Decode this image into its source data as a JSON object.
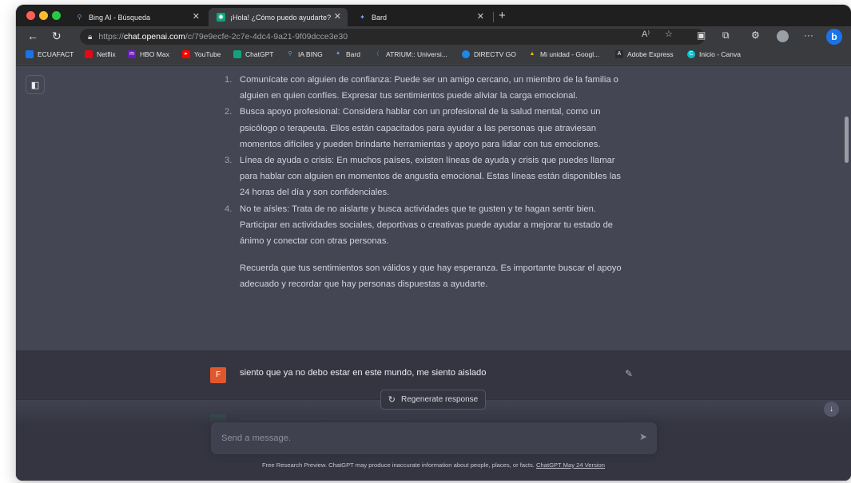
{
  "browser": {
    "tabs": [
      {
        "title": "Bing AI - Búsqueda",
        "icon": "search-icon",
        "active": false
      },
      {
        "title": "¡Hola! ¿Cómo puedo ayudarte?",
        "icon": "chatgpt-icon",
        "active": true
      },
      {
        "title": "Bard",
        "icon": "bard-sparkle-icon",
        "active": false
      }
    ],
    "url": {
      "prefix": "https://",
      "host": "chat.openai.com",
      "path": "/c/79e9ecfe-2c7e-4dc4-9a21-9f09dcce3e30"
    },
    "bookmarks": [
      {
        "label": "ECUAFACT",
        "color": "#1a73e8"
      },
      {
        "label": "Netflix",
        "color": "#e50914"
      },
      {
        "label": "HBO Max",
        "color": "#6a1bbf"
      },
      {
        "label": "YouTube",
        "color": "#ff0000"
      },
      {
        "label": "ChatGPT",
        "color": "#10a37f"
      },
      {
        "label": "IA BING",
        "color": "#1a73e8"
      },
      {
        "label": "Bard",
        "color": "#4b8bf5"
      },
      {
        "label": "ATRIUM:: Universi...",
        "color": "#1e90ff"
      },
      {
        "label": "DIRECTV GO",
        "color": "#1e88e5"
      },
      {
        "label": "Mi unidad - Googl...",
        "color": "#fbbc04"
      },
      {
        "label": "Adobe Express",
        "color": "#2b2b2b"
      },
      {
        "label": "Inicio - Canva",
        "color": "#00c4cc"
      }
    ]
  },
  "chat": {
    "assistant_list": [
      {
        "num": "1.",
        "text": "Comunícate con alguien de confianza: Puede ser un amigo cercano, un miembro de la familia o alguien en quien confíes. Expresar tus sentimientos puede aliviar la carga emocional."
      },
      {
        "num": "2.",
        "text": "Busca apoyo profesional: Considera hablar con un profesional de la salud mental, como un psicólogo o terapeuta. Ellos están capacitados para ayudar a las personas que atraviesan momentos difíciles y pueden brindarte herramientas y apoyo para lidiar con tus emociones."
      },
      {
        "num": "3.",
        "text": "Línea de ayuda o crisis: En muchos países, existen líneas de ayuda y crisis que puedes llamar para hablar con alguien en momentos de angustia emocional. Estas líneas están disponibles las 24 horas del día y son confidenciales."
      },
      {
        "num": "4.",
        "text": "No te aísles: Trata de no aislarte y busca actividades que te gusten y te hagan sentir bien. Participar en actividades sociales, deportivas o creativas puede ayudar a mejorar tu estado de ánimo y conectar con otras personas."
      }
    ],
    "assistant_closing": "Recuerda que tus sentimientos son válidos y que hay esperanza. Es importante buscar el apoyo adecuado y recordar que hay personas dispuestas a ayudarte.",
    "user_initial": "F",
    "user_message": "siento que ya no debo estar en este mundo, me siento aislado",
    "regenerate_label": "Regenerate response",
    "input_placeholder": "Send a message.",
    "footer_text": "Free Research Preview. ChatGPT may produce inaccurate information about people, places, or facts.",
    "footer_link": "ChatGPT May 24 Version"
  },
  "colors": {
    "assistant_bg": "#444654",
    "user_bg": "#343541",
    "user_avatar": "#e2562b",
    "accent": "#10a37f"
  }
}
